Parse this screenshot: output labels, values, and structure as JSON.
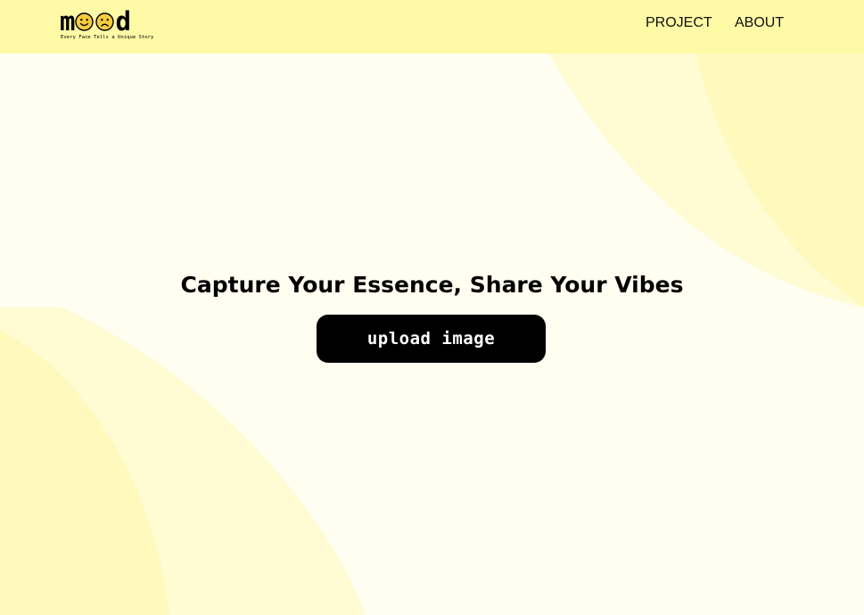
{
  "header": {
    "logo": {
      "letters_start": "m",
      "letters_end": "d",
      "faces": [
        "smiley-face-icon",
        "sad-face-icon"
      ],
      "tagline": "Every Face Tells a Unique Story"
    },
    "nav": [
      {
        "label": "PROJECT"
      },
      {
        "label": "ABOUT"
      }
    ]
  },
  "hero": {
    "title": "Capture Your Essence, Share Your Vibes",
    "upload_label": "upload image"
  },
  "colors": {
    "header_bg": "#fffaa6",
    "page_bg": "#fffef0",
    "shape_light": "#fffbcf",
    "shape_mid": "#fff9bc",
    "face_fill": "#f5cc3d",
    "button_bg": "#000000",
    "button_text": "#ffffff"
  }
}
